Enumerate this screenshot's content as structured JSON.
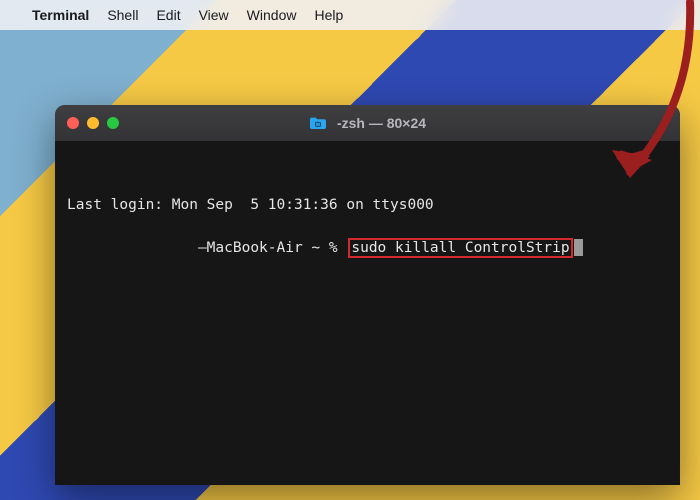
{
  "menubar": {
    "apple_glyph": "",
    "app_name": "Terminal",
    "items": [
      "Shell",
      "Edit",
      "View",
      "Window",
      "Help"
    ]
  },
  "terminal": {
    "window_title": "-zsh — 80×24",
    "lines": {
      "last_login": "Last login: Mon Sep  5 10:31:36 on ttys000",
      "prompt_prefix": "           —MacBook-Air ~ % ",
      "command": "sudo killall ControlStrip"
    }
  },
  "colors": {
    "highlight_border": "#d6292f",
    "arrow": "#9c1f20"
  }
}
